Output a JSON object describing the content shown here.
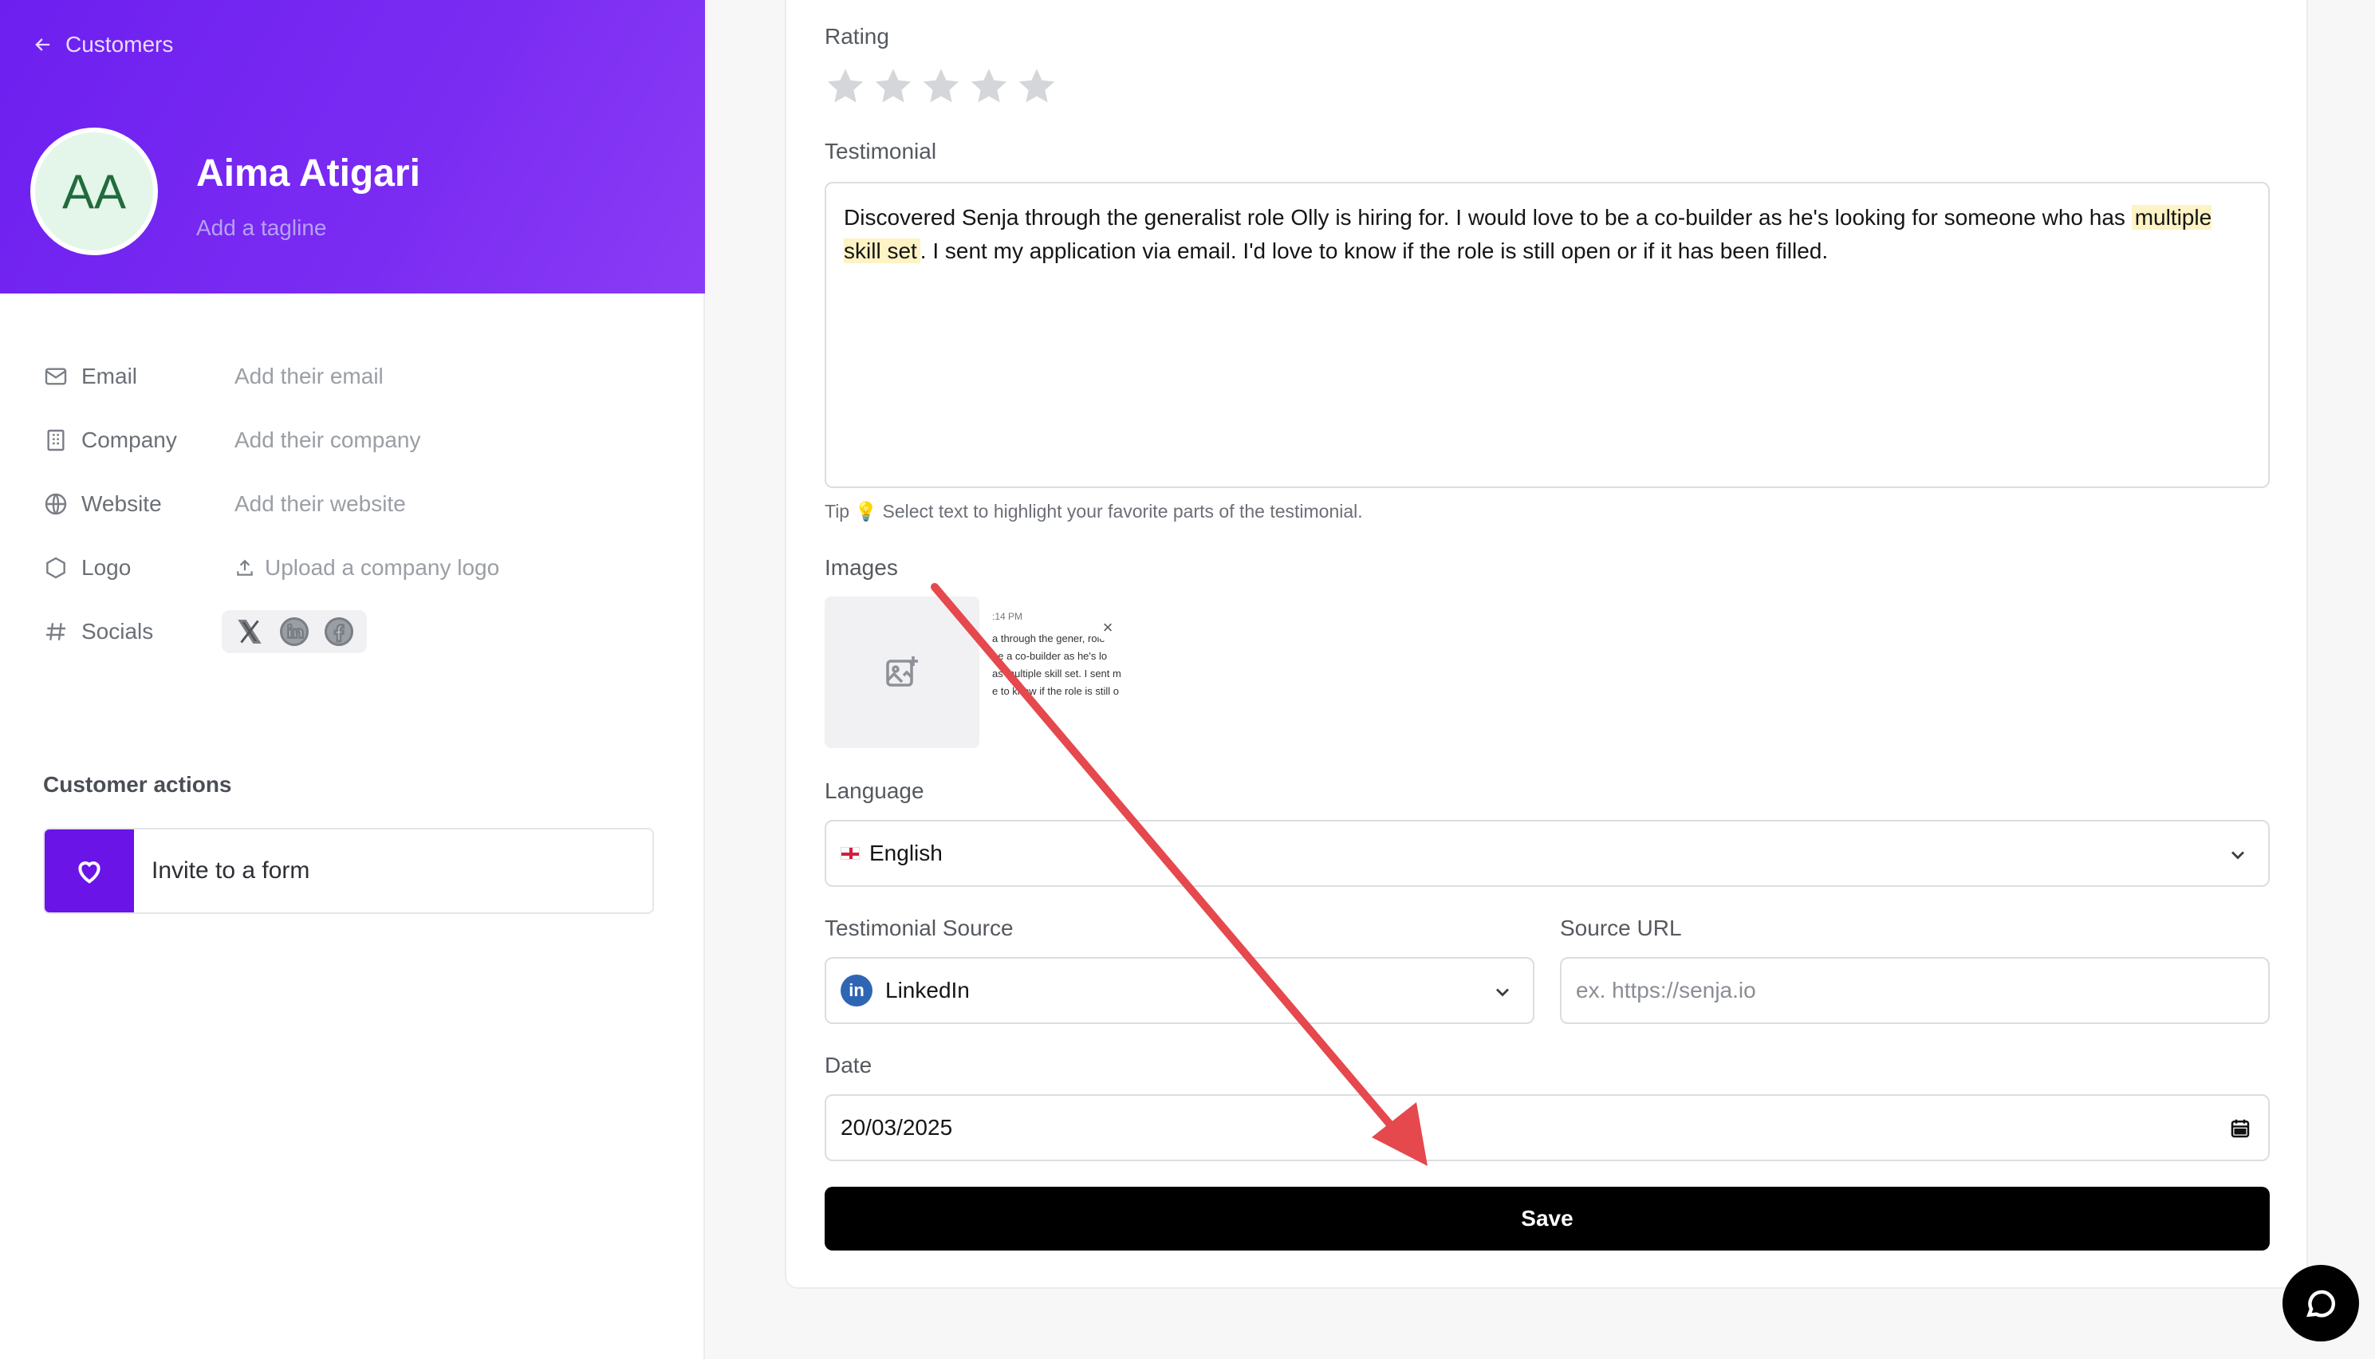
{
  "sidebar": {
    "back_label": "Customers",
    "avatar_initials": "AA",
    "name": "Aima Atigari",
    "tagline_placeholder": "Add a tagline",
    "fields": [
      {
        "label": "Email",
        "value": "Add their email",
        "icon": "mail-icon"
      },
      {
        "label": "Company",
        "value": "Add their company",
        "icon": "building-icon"
      },
      {
        "label": "Website",
        "value": "Add their website",
        "icon": "globe-icon"
      },
      {
        "label": "Logo",
        "value": "Upload a company logo",
        "icon": "hexagon-icon"
      },
      {
        "label": "Socials",
        "value": "",
        "icon": "hash-icon"
      }
    ],
    "actions_title": "Customer actions",
    "invite_label": "Invite to a form"
  },
  "form": {
    "rating_label": "Rating",
    "rating_value": 0,
    "rating_max": 5,
    "testimonial_label": "Testimonial",
    "testimonial_before": "Discovered Senja through the generalist role Olly is hiring for. I would love to be a co-builder as he's looking for someone who has ",
    "testimonial_highlight": "multiple skill set",
    "testimonial_after": ". I sent my application via email. I'd love to know if the role is still open or if it has been filled.",
    "tip": "Tip 💡 Select text to highlight your favorite parts of the testimonial.",
    "images_label": "Images",
    "thumb_time": ":14 PM",
    "thumb_lines": [
      "a through the gener,    role",
      "be a co-builder as he's lo",
      "as multiple skill set. I sent m",
      "e to know if the role is still o"
    ],
    "language_label": "Language",
    "language_value": "English",
    "source_label": "Testimonial Source",
    "source_value": "LinkedIn",
    "source_url_label": "Source URL",
    "source_url_placeholder": "ex. https://senja.io",
    "date_label": "Date",
    "date_value": "20/03/2025",
    "save_label": "Save"
  },
  "colors": {
    "header_purple": "#6d1ff0",
    "invite_purple": "#6a14e8",
    "arrow_red": "#e5484d",
    "highlight_yellow": "#fdf3c4"
  }
}
